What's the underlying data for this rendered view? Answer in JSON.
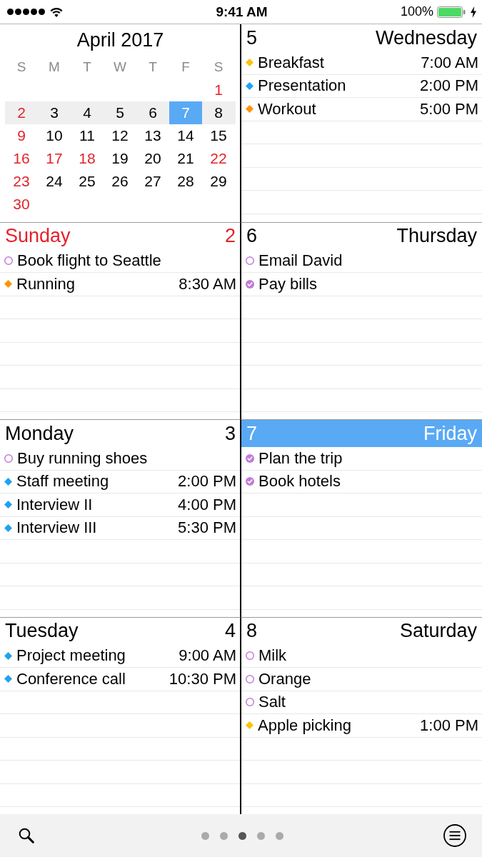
{
  "status_bar": {
    "time": "9:41 AM",
    "battery": "100%"
  },
  "month_calendar": {
    "title": "April 2017",
    "weekdays": [
      "S",
      "M",
      "T",
      "W",
      "T",
      "F",
      "S"
    ],
    "weeks": [
      {
        "current": false,
        "days": [
          {
            "label": "1",
            "holiday": true,
            "selected": false
          }
        ]
      },
      {
        "current": true,
        "days": [
          {
            "label": "2",
            "holiday": true,
            "selected": false
          },
          {
            "label": "3",
            "holiday": false,
            "selected": false
          },
          {
            "label": "4",
            "holiday": false,
            "selected": false
          },
          {
            "label": "5",
            "holiday": false,
            "selected": false
          },
          {
            "label": "6",
            "holiday": false,
            "selected": false
          },
          {
            "label": "7",
            "holiday": false,
            "selected": true
          },
          {
            "label": "8",
            "holiday": false,
            "selected": false
          }
        ]
      },
      {
        "current": false,
        "days": [
          {
            "label": "9",
            "holiday": true,
            "selected": false
          },
          {
            "label": "10",
            "holiday": false,
            "selected": false
          },
          {
            "label": "11",
            "holiday": false,
            "selected": false
          },
          {
            "label": "12",
            "holiday": false,
            "selected": false
          },
          {
            "label": "13",
            "holiday": false,
            "selected": false
          },
          {
            "label": "14",
            "holiday": false,
            "selected": false
          },
          {
            "label": "15",
            "holiday": false,
            "selected": false
          }
        ]
      },
      {
        "current": false,
        "days": [
          {
            "label": "16",
            "holiday": true,
            "selected": false
          },
          {
            "label": "17",
            "holiday": true,
            "selected": false
          },
          {
            "label": "18",
            "holiday": true,
            "selected": false
          },
          {
            "label": "19",
            "holiday": false,
            "selected": false
          },
          {
            "label": "20",
            "holiday": false,
            "selected": false
          },
          {
            "label": "21",
            "holiday": false,
            "selected": false
          },
          {
            "label": "22",
            "holiday": true,
            "selected": false
          }
        ]
      },
      {
        "current": false,
        "days": [
          {
            "label": "23",
            "holiday": true,
            "selected": false
          },
          {
            "label": "24",
            "holiday": false,
            "selected": false
          },
          {
            "label": "25",
            "holiday": false,
            "selected": false
          },
          {
            "label": "26",
            "holiday": false,
            "selected": false
          },
          {
            "label": "27",
            "holiday": false,
            "selected": false
          },
          {
            "label": "28",
            "holiday": false,
            "selected": false
          },
          {
            "label": "29",
            "holiday": false,
            "selected": false
          }
        ]
      },
      {
        "current": false,
        "days": [
          {
            "label": "30",
            "holiday": true,
            "selected": false
          }
        ]
      }
    ]
  },
  "days": [
    {
      "name": "Sunday",
      "number": "2",
      "holiday": true,
      "selected": false,
      "events": [
        {
          "kind": "task",
          "title": "Book flight to Seattle",
          "checked": false,
          "color": "#c17bd8"
        },
        {
          "kind": "event",
          "title": "Running",
          "time": "8:30 AM",
          "color": "#ff9300"
        }
      ]
    },
    {
      "name": "Monday",
      "number": "3",
      "holiday": false,
      "selected": false,
      "events": [
        {
          "kind": "task",
          "title": "Buy running shoes",
          "checked": false,
          "color": "#c17bd8"
        },
        {
          "kind": "event",
          "title": "Staff meeting",
          "time": "2:00 PM",
          "color": "#1ea2f1"
        },
        {
          "kind": "event",
          "title": "Interview II",
          "time": "4:00 PM",
          "color": "#1ea2f1"
        },
        {
          "kind": "event",
          "title": "Interview III",
          "time": "5:30 PM",
          "color": "#1ea2f1"
        }
      ]
    },
    {
      "name": "Tuesday",
      "number": "4",
      "holiday": false,
      "selected": false,
      "events": [
        {
          "kind": "event",
          "title": "Project meeting",
          "time": "9:00 AM",
          "color": "#1ea2f1"
        },
        {
          "kind": "event",
          "title": "Conference call",
          "time": "10:30 PM",
          "color": "#1ea2f1"
        }
      ]
    },
    {
      "name": "Wednesday",
      "number": "5",
      "holiday": false,
      "selected": false,
      "events": [
        {
          "kind": "event",
          "title": "Breakfast",
          "time": "7:00 AM",
          "color": "#ffc107"
        },
        {
          "kind": "event",
          "title": "Presentation",
          "time": "2:00 PM",
          "color": "#1ea2f1"
        },
        {
          "kind": "event",
          "title": "Workout",
          "time": "5:00 PM",
          "color": "#ff9300"
        }
      ]
    },
    {
      "name": "Thursday",
      "number": "6",
      "holiday": false,
      "selected": false,
      "events": [
        {
          "kind": "task",
          "title": "Email David",
          "checked": false,
          "color": "#c17bd8"
        },
        {
          "kind": "task",
          "title": "Pay bills",
          "checked": true,
          "color": "#c17bd8"
        }
      ]
    },
    {
      "name": "Friday",
      "number": "7",
      "holiday": false,
      "selected": true,
      "events": [
        {
          "kind": "task",
          "title": "Plan the trip",
          "checked": true,
          "color": "#c17bd8"
        },
        {
          "kind": "task",
          "title": "Book hotels",
          "checked": true,
          "color": "#c17bd8"
        }
      ]
    },
    {
      "name": "Saturday",
      "number": "8",
      "holiday": false,
      "selected": false,
      "events": [
        {
          "kind": "task",
          "title": "Milk",
          "checked": false,
          "color": "#c17bd8"
        },
        {
          "kind": "task",
          "title": "Orange",
          "checked": false,
          "color": "#c17bd8"
        },
        {
          "kind": "task",
          "title": "Salt",
          "checked": false,
          "color": "#c17bd8"
        },
        {
          "kind": "event",
          "title": "Apple picking",
          "time": "1:00 PM",
          "color": "#ffc107"
        }
      ]
    }
  ],
  "toolbar": {
    "pages": [
      {
        "selected": false
      },
      {
        "selected": false
      },
      {
        "selected": true
      },
      {
        "selected": false
      },
      {
        "selected": false
      }
    ]
  }
}
